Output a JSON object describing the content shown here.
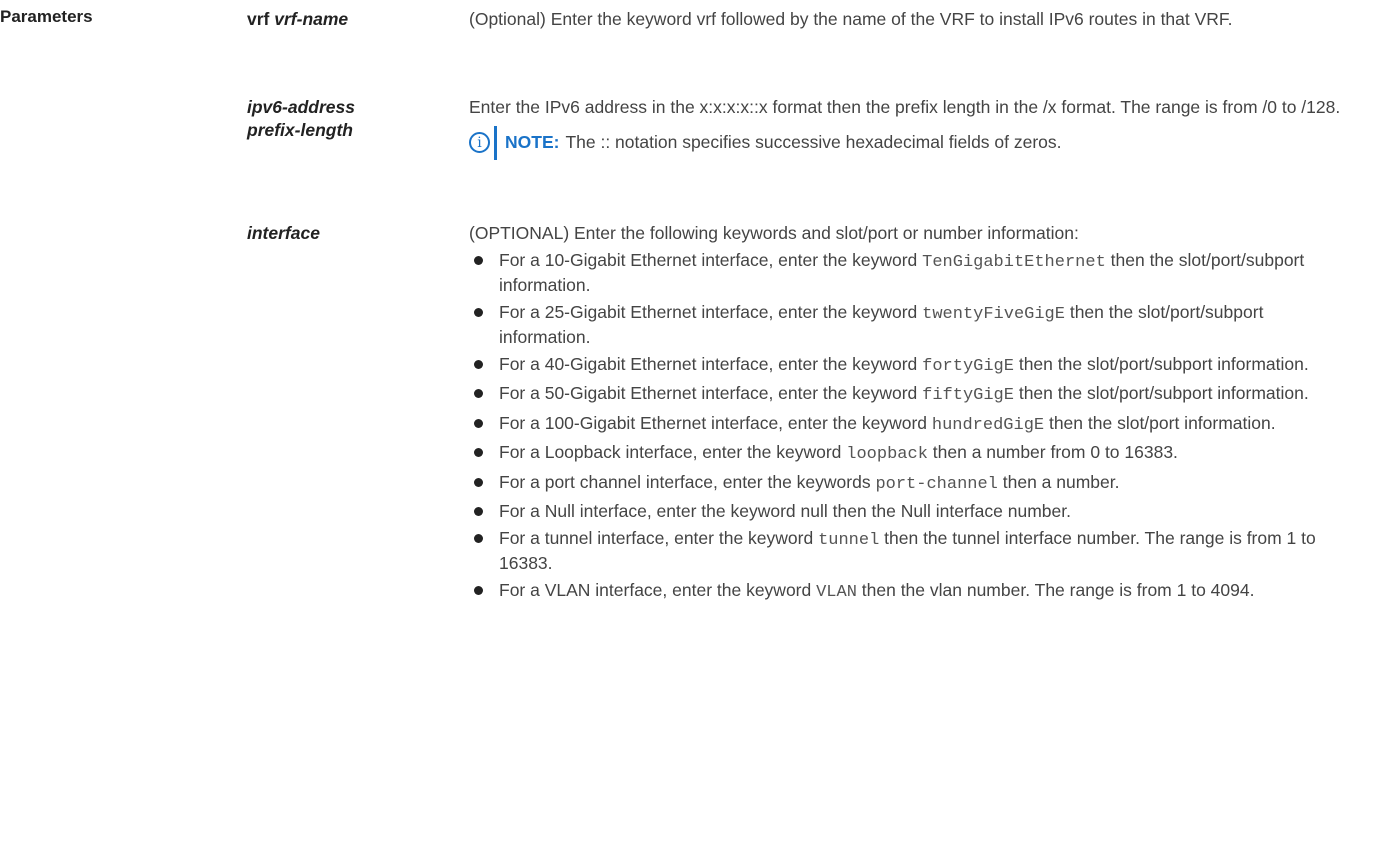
{
  "section": {
    "heading": "Parameters"
  },
  "params": [
    {
      "term_bold": "vrf",
      "term_italic": "vrf-name",
      "desc": "(Optional) Enter the keyword vrf followed by the name of the VRF to install IPv6 routes in that VRF."
    },
    {
      "term_line1": "ipv6-address",
      "term_line2": "prefix-length",
      "desc": "Enter the IPv6 address in the x:x:x:x::x format then the prefix length in the /x format. The range is from /0 to /128.",
      "note_label": "NOTE:",
      "note_text": "The :: notation specifies successive hexadecimal fields of zeros.",
      "note_icon": "info-icon"
    },
    {
      "term": "interface",
      "intro": "(OPTIONAL) Enter the following keywords and slot/port or number information:",
      "bullets": [
        {
          "pre": "For a 10-Gigabit Ethernet interface, enter the keyword ",
          "code": "TenGigabitEthernet",
          "post": " then the slot/port/subport information."
        },
        {
          "pre": "For a 25-Gigabit Ethernet interface, enter the keyword ",
          "code": "twentyFiveGigE",
          "post": " then the slot/port/subport information."
        },
        {
          "pre": "For a 40-Gigabit Ethernet interface, enter the keyword ",
          "code": "fortyGigE",
          "post": " then the slot/port/subport information."
        },
        {
          "pre": "For a 50-Gigabit Ethernet interface, enter the keyword ",
          "code": "fiftyGigE",
          "post": " then the slot/port/subport information."
        },
        {
          "pre": "For a 100-Gigabit Ethernet interface, enter the keyword ",
          "code": "hundredGigE",
          "post": " then the slot/port information."
        },
        {
          "pre": "For a Loopback interface, enter the keyword ",
          "code": "loopback",
          "post": " then a number from 0 to 16383."
        },
        {
          "pre": "For a port channel interface, enter the keywords ",
          "code": "port-channel",
          "post": " then a number."
        },
        {
          "pre": "For a Null interface, enter the keyword null then the Null interface number.",
          "code": "",
          "post": ""
        },
        {
          "pre": "For a tunnel interface, enter the keyword ",
          "code": "tunnel",
          "post": " then the tunnel interface number. The range is from 1 to 16383."
        },
        {
          "pre": "For a VLAN interface, enter the keyword ",
          "code": "VLAN",
          "post": " then the vlan number. The range is from 1 to 4094."
        }
      ]
    }
  ],
  "colors": {
    "note_accent": "#1a73c8",
    "text": "#444444",
    "heading": "#222222"
  }
}
